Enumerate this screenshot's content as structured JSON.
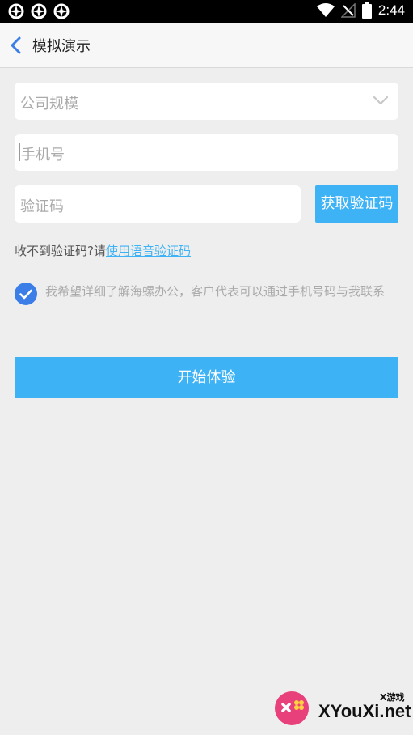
{
  "status_bar": {
    "time": "2:44",
    "icons": [
      "app-notification-icon",
      "app-notification-icon",
      "app-notification-icon",
      "wifi-icon",
      "no-signal-icon",
      "battery-icon"
    ]
  },
  "header": {
    "title": "模拟演示",
    "back_icon": "chevron-left-icon"
  },
  "form": {
    "company_size_placeholder": "公司规模",
    "phone_placeholder": "手机号",
    "verification_code_placeholder": "验证码",
    "get_code_label": "获取验证码",
    "voice_prompt": "收不到验证码?请",
    "voice_link": "使用语音验证码",
    "consent_text": "我希望详细了解海螺办公，客户代表可以通过手机号码与我联系",
    "consent_checked": true,
    "submit_label": "开始体验"
  },
  "watermark": {
    "small_text": "X游戏",
    "brand": "XYouXi.net"
  },
  "colors": {
    "accent": "#3db2f5",
    "checkbox": "#3b7ee8",
    "background": "#eeeeee"
  }
}
